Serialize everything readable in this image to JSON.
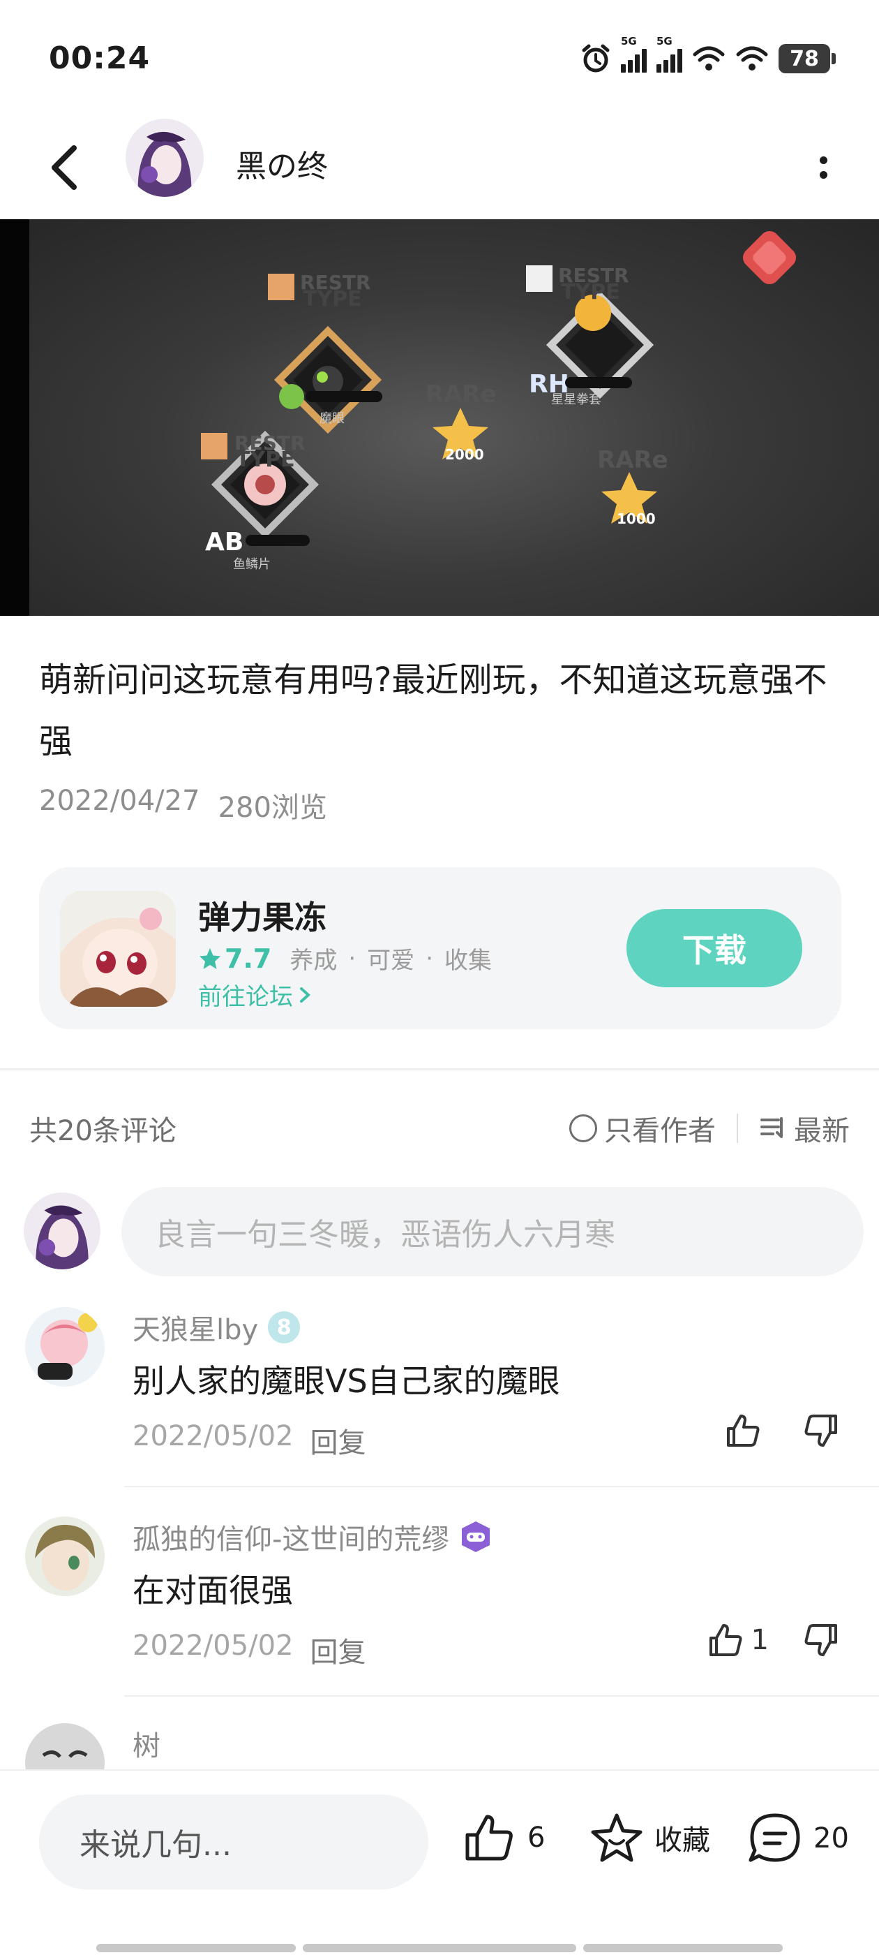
{
  "status_bar": {
    "time": "00:24",
    "net1": "5G",
    "net2": "5G",
    "battery": "78"
  },
  "header": {
    "username": "黑の终"
  },
  "hero": {
    "icon_names": [
      "restr-type-card",
      "rare-items-star",
      "close-badge"
    ]
  },
  "post": {
    "title": "萌新问问这玩意有用吗?最近刚玩，不知道这玩意强不强",
    "date": "2022/04/27",
    "views": "280浏览"
  },
  "game_card": {
    "name": "弹力果冻",
    "rating": "7.7",
    "tags": [
      "养成",
      "·",
      "可爱",
      "·",
      "收集"
    ],
    "forum_link": "前往论坛",
    "download_label": "下载",
    "accent_color": "#5ed3bf"
  },
  "comments_header": {
    "count_text": "共20条评论",
    "author_only": "只看作者",
    "sort": "最新"
  },
  "comment_input": {
    "placeholder": "良言一句三冬暖，恶语伤人六月寒"
  },
  "comments": [
    {
      "user": "天狼星lby",
      "badge": "8",
      "text": "别人家的魔眼VS自己家的魔眼",
      "date": "2022/05/02",
      "reply": "回复",
      "likes": ""
    },
    {
      "user": "孤独的信仰-这世间的荒缪",
      "badge": "",
      "text": "在对面很强",
      "date": "2022/05/02",
      "reply": "回复",
      "likes": "1"
    },
    {
      "user": "树",
      "badge": "",
      "text": "",
      "date": "",
      "reply": "",
      "likes": ""
    }
  ],
  "bottom_bar": {
    "input_placeholder": "来说几句...",
    "like_count": "6",
    "favorite_label": "收藏",
    "comment_count": "20"
  }
}
